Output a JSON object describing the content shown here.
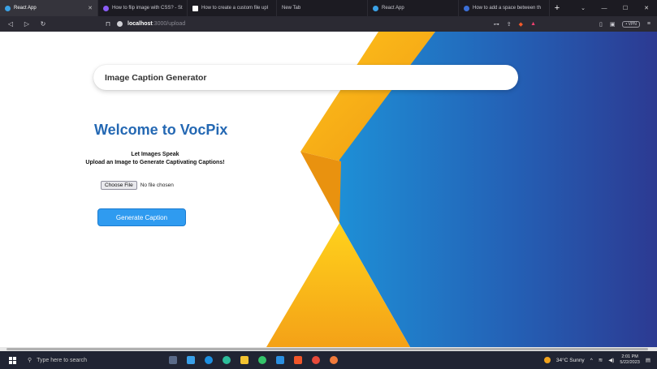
{
  "browser": {
    "tabs": [
      {
        "label": "React App",
        "color": "#3ba2e6"
      },
      {
        "label": "How to flip image with CSS? - St",
        "color": "#8a5cf5"
      },
      {
        "label": "How to create a custom file upl",
        "color": "#ffffff"
      },
      {
        "label": "New Tab",
        "color": "#555555"
      },
      {
        "label": "React App",
        "color": "#3ba2e6"
      },
      {
        "label": "How to add a space between th",
        "color": "#3b6fd6"
      }
    ],
    "new_tab": "+",
    "window_controls": {
      "dropdown": "⌄",
      "minimize": "—",
      "maximize": "☐",
      "close": "✕"
    },
    "url_host": "localhost",
    "url_path": ":3000/upload",
    "vpn_label": "• VPN"
  },
  "app": {
    "navbar_title": "Image Caption Generator",
    "welcome": "Welcome to VocPix",
    "tagline_1": "Let Images Speak",
    "tagline_2": "Upload an Image to Generate Captivating Captions!",
    "choose_file_label": "Choose File",
    "no_file_text": "No file chosen",
    "generate_label": "Generate Caption"
  },
  "taskbar": {
    "search_placeholder": "Type here to search",
    "weather": "34°C  Sunny",
    "time": "2:01 PM",
    "date": "5/22/2023"
  },
  "colors": {
    "accent_blue": "#2468b3",
    "button_blue": "#2f9bf0",
    "bg_yellow": "#f6b21c",
    "bg_blue": "#1f74c9",
    "bg_navy": "#2c3a92"
  }
}
